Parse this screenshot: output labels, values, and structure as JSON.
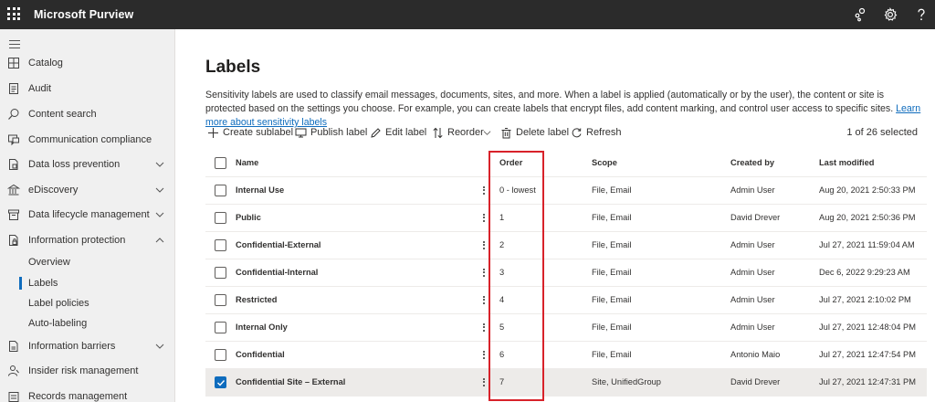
{
  "app": {
    "title": "Microsoft Purview"
  },
  "sidebar": {
    "items": [
      {
        "label": "Catalog",
        "icon": "catalog-icon"
      },
      {
        "label": "Audit",
        "icon": "audit-icon"
      },
      {
        "label": "Content search",
        "icon": "search-icon"
      },
      {
        "label": "Communication compliance",
        "icon": "chat-icon"
      },
      {
        "label": "Data loss prevention",
        "icon": "shield-doc-icon",
        "expandable": true
      },
      {
        "label": "eDiscovery",
        "icon": "bank-icon",
        "expandable": true
      },
      {
        "label": "Data lifecycle management",
        "icon": "archive-icon",
        "expandable": true
      },
      {
        "label": "Information protection",
        "icon": "lock-doc-icon",
        "expanded": true
      },
      {
        "label": "Information barriers",
        "icon": "barrier-icon",
        "expandable": true
      },
      {
        "label": "Insider risk management",
        "icon": "person-icon"
      },
      {
        "label": "Records management",
        "icon": "records-icon"
      }
    ],
    "subitems": [
      {
        "label": "Overview",
        "active": false
      },
      {
        "label": "Labels",
        "active": true
      },
      {
        "label": "Label policies",
        "active": false
      },
      {
        "label": "Auto-labeling",
        "active": false
      }
    ]
  },
  "page": {
    "title": "Labels",
    "description": "Sensitivity labels are used to classify email messages, documents, sites, and more. When a label is applied (automatically or by the user), the content or site is protected based on the settings you choose. For example, you can create labels that encrypt files, add content marking, and control user access to specific sites.",
    "learn_more": "Learn more about sensitivity labels"
  },
  "toolbar": {
    "create_sublabel": "Create sublabel",
    "publish_label": "Publish label",
    "edit_label": "Edit label",
    "reorder": "Reorder",
    "delete_label": "Delete label",
    "refresh": "Refresh",
    "selection_count": "1 of 26 selected"
  },
  "table": {
    "headers": {
      "name": "Name",
      "order": "Order",
      "scope": "Scope",
      "created_by": "Created by",
      "last_modified": "Last modified"
    },
    "rows": [
      {
        "name": "Internal Use",
        "order": "0 - lowest",
        "scope": "File, Email",
        "created_by": "Admin User",
        "last_modified": "Aug 20, 2021 2:50:33 PM",
        "checked": false
      },
      {
        "name": "Public",
        "order": "1",
        "scope": "File, Email",
        "created_by": "David Drever",
        "last_modified": "Aug 20, 2021 2:50:36 PM",
        "checked": false
      },
      {
        "name": "Confidential-External",
        "order": "2",
        "scope": "File, Email",
        "created_by": "Admin User",
        "last_modified": "Jul 27, 2021 11:59:04 AM",
        "checked": false
      },
      {
        "name": "Confidential-Internal",
        "order": "3",
        "scope": "File, Email",
        "created_by": "Admin User",
        "last_modified": "Dec 6, 2022 9:29:23 AM",
        "checked": false
      },
      {
        "name": "Restricted",
        "order": "4",
        "scope": "File, Email",
        "created_by": "Admin User",
        "last_modified": "Jul 27, 2021 2:10:02 PM",
        "checked": false
      },
      {
        "name": "Internal Only",
        "order": "5",
        "scope": "File, Email",
        "created_by": "Admin User",
        "last_modified": "Jul 27, 2021 12:48:04 PM",
        "checked": false
      },
      {
        "name": "Confidential",
        "order": "6",
        "scope": "File, Email",
        "created_by": "Antonio Maio",
        "last_modified": "Jul 27, 2021 12:47:54 PM",
        "checked": false
      },
      {
        "name": "Confidential Site – External",
        "order": "7",
        "scope": "Site, UnifiedGroup",
        "created_by": "David Drever",
        "last_modified": "Jul 27, 2021 12:47:31 PM",
        "checked": true
      }
    ]
  },
  "colors": {
    "topbar": "#2b2b2b",
    "accent": "#0f6cbd",
    "highlight": "#d8222a",
    "sidebar": "#f0f0f0"
  }
}
